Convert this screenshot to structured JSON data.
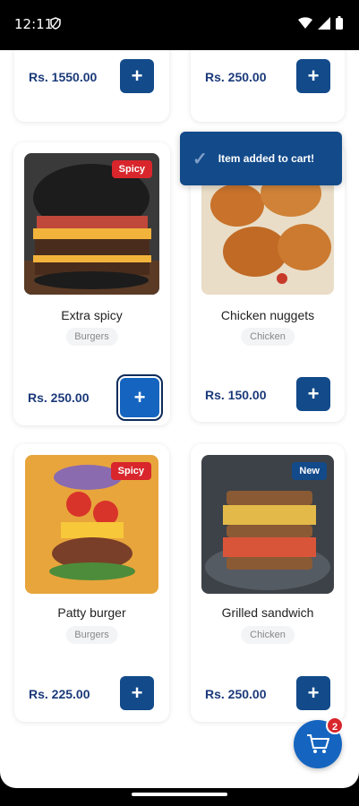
{
  "status": {
    "time": "12:11"
  },
  "top_row": [
    {
      "price": "Rs. 1550.00"
    },
    {
      "price": "Rs. 250.00"
    }
  ],
  "products": [
    {
      "title": "Extra spicy",
      "category": "Burgers",
      "price": "Rs. 250.00",
      "badge": "Spicy"
    },
    {
      "title": "Chicken nuggets",
      "category": "Chicken",
      "price": "Rs. 150.00",
      "badge": ""
    },
    {
      "title": "Patty burger",
      "category": "Burgers",
      "price": "Rs. 225.00",
      "badge": "Spicy"
    },
    {
      "title": "Grilled sandwich",
      "category": "Chicken",
      "price": "Rs. 250.00",
      "badge": "New"
    }
  ],
  "add_label": "+",
  "toast": {
    "check": "✓",
    "message": "Item added to cart!"
  },
  "cart": {
    "count": "2"
  },
  "colors": {
    "primary": "#124a8a",
    "spicy": "#d8262c",
    "price": "#1b3a7a"
  }
}
